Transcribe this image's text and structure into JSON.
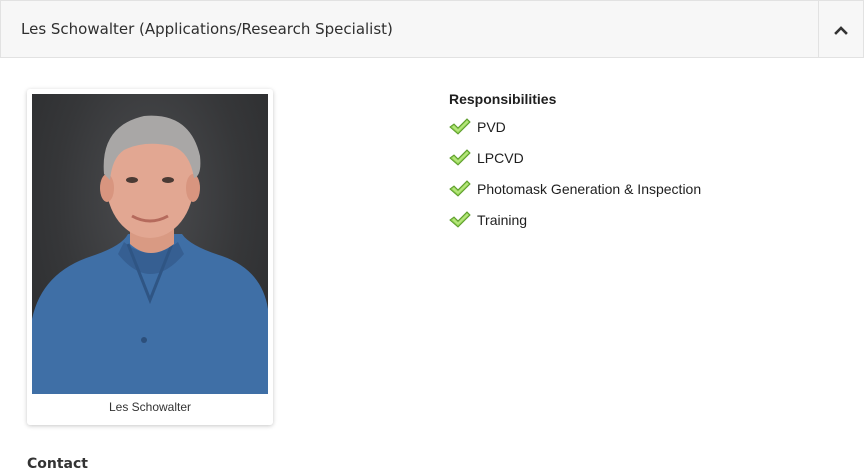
{
  "header": {
    "title": "Les Schowalter (Applications/Research Specialist)",
    "toggle_icon": "chevron-up-icon"
  },
  "profile": {
    "caption": "Les Schowalter"
  },
  "responsibilities": {
    "heading": "Responsibilities",
    "icon": "checkmark-icon",
    "icon_color": "#7ac143",
    "items": [
      {
        "label": "PVD"
      },
      {
        "label": "LPCVD"
      },
      {
        "label": "Photomask Generation & Inspection"
      },
      {
        "label": "Training"
      }
    ]
  },
  "contact": {
    "heading": "Contact"
  }
}
